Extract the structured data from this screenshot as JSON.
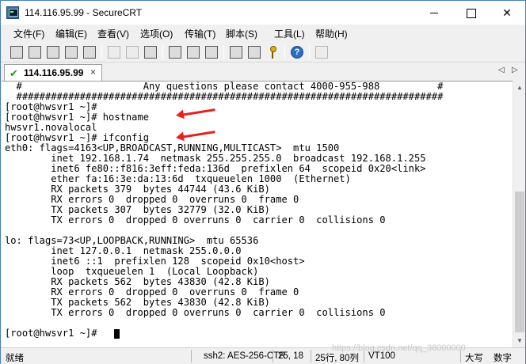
{
  "window": {
    "title": "114.116.95.99 - SecureCRT"
  },
  "menu": [
    "文件(F)",
    "编辑(E)",
    "查看(V)",
    "选项(O)",
    "传输(T)",
    "脚本(S)",
    "工具(L)",
    "帮助(H)"
  ],
  "toolbar": {
    "icons": [
      "connect-icon",
      "quick-connect-icon",
      "connect-in-tab-icon",
      "reconnect-icon",
      "disconnect-icon",
      "copy-icon",
      "paste-icon",
      "find-icon",
      "print-icon",
      "print-setup-icon",
      "print-screen-icon",
      "session-options-icon",
      "global-options-icon",
      "key-icon",
      "help-icon",
      "keymap-icon"
    ],
    "help_glyph": "?"
  },
  "tab": {
    "label": "114.116.95.99",
    "check": "✔",
    "close": "×",
    "nav_left": "◁",
    "nav_right": "▷"
  },
  "terminal": {
    "lines": [
      "  #                     Any questions please contact 4000-955-988          #",
      "  ##########################################################################",
      "[root@hwsvr1 ~]#",
      "[root@hwsvr1 ~]# hostname",
      "hwsvr1.novalocal",
      "[root@hwsvr1 ~]# ifconfig",
      "eth0: flags=4163<UP,BROADCAST,RUNNING,MULTICAST>  mtu 1500",
      "        inet 192.168.1.74  netmask 255.255.255.0  broadcast 192.168.1.255",
      "        inet6 fe80::f816:3eff:feda:136d  prefixlen 64  scopeid 0x20<link>",
      "        ether fa:16:3e:da:13:6d  txqueuelen 1000  (Ethernet)",
      "        RX packets 379  bytes 44744 (43.6 KiB)",
      "        RX errors 0  dropped 0  overruns 0  frame 0",
      "        TX packets 307  bytes 32779 (32.0 KiB)",
      "        TX errors 0  dropped 0 overruns 0  carrier 0  collisions 0",
      "",
      "lo: flags=73<UP,LOOPBACK,RUNNING>  mtu 65536",
      "        inet 127.0.0.1  netmask 255.0.0.0",
      "        inet6 ::1  prefixlen 128  scopeid 0x10<host>",
      "        loop  txqueuelen 1  (Local Loopback)",
      "        RX packets 562  bytes 43830 (42.8 KiB)",
      "        RX errors 0  dropped 0  overruns 0  frame 0",
      "        TX packets 562  bytes 43830 (42.8 KiB)",
      "        TX errors 0  dropped 0 overruns 0  carrier 0  collisions 0",
      "",
      "[root@hwsvr1 ~]# "
    ]
  },
  "status": {
    "ready": "就绪",
    "cipher": "ssh2: AES-256-CTR",
    "cursor_pos": "25, 18",
    "size": "25行, 80列",
    "emulation": "VT100",
    "caps": "大写",
    "num": "数字"
  },
  "watermark": "https://blog.csdn.net/qq_38000000",
  "colors": {
    "annotation_arrow": "#e8211f",
    "tab_check": "#1d9a1d",
    "window_border": "#4a7fc1"
  }
}
